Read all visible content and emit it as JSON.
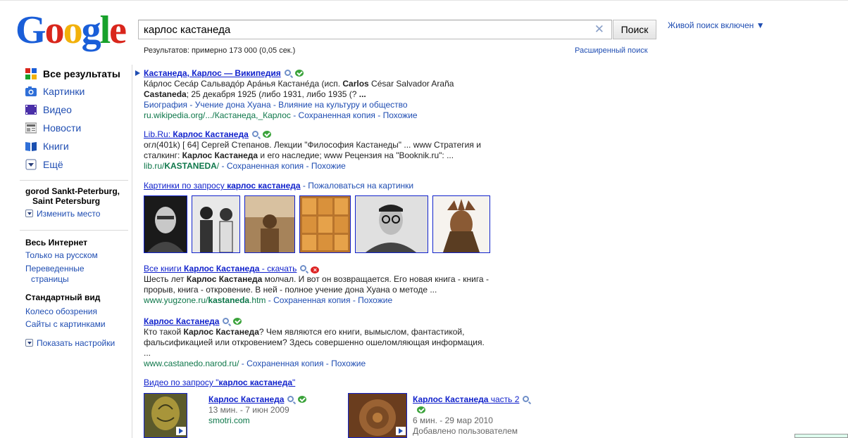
{
  "header": {
    "logo_letters": [
      {
        "ch": "G",
        "color": "#1a5ed8"
      },
      {
        "ch": "o",
        "color": "#d9261c"
      },
      {
        "ch": "o",
        "color": "#f2b10b"
      },
      {
        "ch": "g",
        "color": "#1a5ed8"
      },
      {
        "ch": "l",
        "color": "#17a12b"
      },
      {
        "ch": "e",
        "color": "#d9261c"
      }
    ],
    "query": "карлос кастанеда",
    "search_button": "Поиск",
    "live_search": "Живой поиск включен ▼",
    "stats": "Результатов: примерно 173 000 (0,05 сек.)",
    "advanced": "Расширенный поиск"
  },
  "sidebar": {
    "nav": [
      {
        "label": "Все результаты",
        "active": true,
        "icon": "all-results-icon"
      },
      {
        "label": "Картинки",
        "active": false,
        "icon": "camera-icon"
      },
      {
        "label": "Видео",
        "active": false,
        "icon": "video-icon"
      },
      {
        "label": "Новости",
        "active": false,
        "icon": "news-icon"
      },
      {
        "label": "Книги",
        "active": false,
        "icon": "book-icon"
      },
      {
        "label": "Ещё",
        "active": false,
        "icon": "chevron-down-icon"
      }
    ],
    "location_line1": "gorod Sankt-Peterburg,",
    "location_line2": "Saint Petersburg",
    "change_place": "Изменить место",
    "web_header": "Весь Интернет",
    "web_links": [
      "Только на русском",
      "Переведенные",
      "страницы"
    ],
    "view_header": "Стандартный вид",
    "view_links": [
      "Колесо обозрения",
      "Сайты с картинками"
    ],
    "show_settings": "Показать настройки"
  },
  "results": {
    "r1": {
      "title": "Кастанеда, Карлос — Википедия",
      "snip1a": "Ка́рлос Сеса́р Сальвадо́р Ара́нья Кастане́да (исп. ",
      "snip1b": "Carlos",
      "snip1c": " César Salvador Araña",
      "snip2a": "Castaneda",
      "snip2b": "; 25 декабря 1925 (либо 1931, либо 1935 (? ",
      "snip2c": "...",
      "sublinks": "Биография - Учение дона Хуана - Влияние на культуру и общество",
      "url": "ru.wikipedia.org/.../Кастанеда,_Карлос",
      "cache": "Сохраненная копия",
      "similar": "Похожие"
    },
    "r2": {
      "title_a": "Lib.Ru: ",
      "title_b": "Карлос Кастанеда",
      "snip1": "огл(401k) [ 64] Сергей Степанов. Лекции \"Философия Кастанеды\" ... www Стратегия и",
      "snip2a": "сталкинг: ",
      "snip2b": "Карлос Кастанеда",
      "snip2c": " и его наследие; www Рецензия на \"Booknik.ru\": ...",
      "url_a": "lib.ru/",
      "url_b": "KASTANEDA",
      "url_c": "/",
      "cache": "Сохраненная копия",
      "similar": "Похожие"
    },
    "images": {
      "title_a": "Картинки по запросу ",
      "title_b": "карлос кастанеда",
      "complain": "Пожаловаться на картинки"
    },
    "r3": {
      "title_a": "Все книги ",
      "title_b": "Карлос Кастанеда",
      "title_c": " - скачать",
      "snip1a": "Шесть лет ",
      "snip1b": "Карлос Кастанеда",
      "snip1c": " молчал. И вот он возвращается. Его новая книга - книга -",
      "snip2": "прорыв, книга - откровение. В ней - полное учение дона Хуана о методе ...",
      "url_a": "www.yugzone.ru/",
      "url_b": "kastaneda",
      "url_c": ".htm",
      "cache": "Сохраненная копия",
      "similar": "Похожие"
    },
    "r4": {
      "title": "Карлос Кастанеда",
      "snip1a": "Кто такой ",
      "snip1b": "Карлос Кастанеда",
      "snip1c": "? Чем являются его книги, вымыслом, фантастикой,",
      "snip2": "фальсификацией или откровением? Здесь совершенно ошеломляющая информация.",
      "snip3": "...",
      "url": "www.castanedo.narod.ru/",
      "cache": "Сохраненная копия",
      "similar": "Похожие"
    },
    "video": {
      "title_a": "Видео по запросу \"",
      "title_b": "карлос кастанеда",
      "title_c": "\"",
      "v1_title": "Карлос Кастанеда",
      "v1_meta": "13 мин. - 7 июн 2009",
      "v1_site": "smotri.com",
      "v2_title_a": "Карлос Кастанеда",
      "v2_title_b": " часть 2",
      "v2_meta": "6 мин. - 29 мар 2010",
      "v2_site": "Добавлено пользователем"
    }
  }
}
